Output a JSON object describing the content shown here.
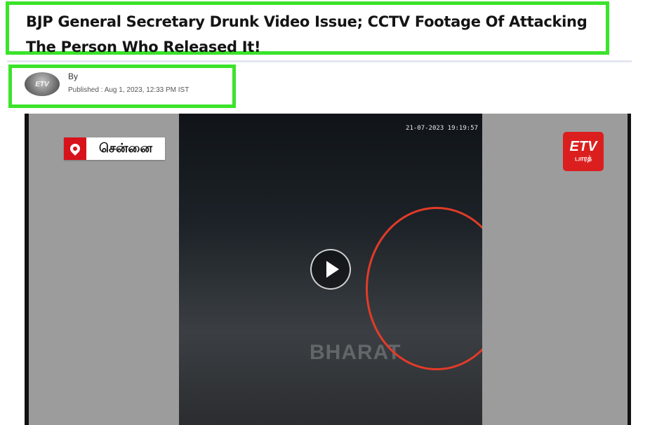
{
  "article": {
    "headline": "BJP General Secretary Drunk Video Issue; CCTV Footage Of Attacking The Person Who Released It!",
    "byline_label": "By",
    "published": "Published : Aug 1, 2023, 12:33 PM IST"
  },
  "video": {
    "location": "சென்னை",
    "cctv_timestamp": "21-07-2023 19:19:57",
    "logo_mark": "ETV",
    "logo_sub": "பாரத்",
    "watermark": "BHARAT"
  },
  "icons": [
    "location-pin-icon",
    "play-icon",
    "etv-bharat-logo"
  ],
  "colors": {
    "highlight_green": "#3be32a",
    "brand_red": "#d8121b",
    "circle_red": "#e33b28"
  }
}
